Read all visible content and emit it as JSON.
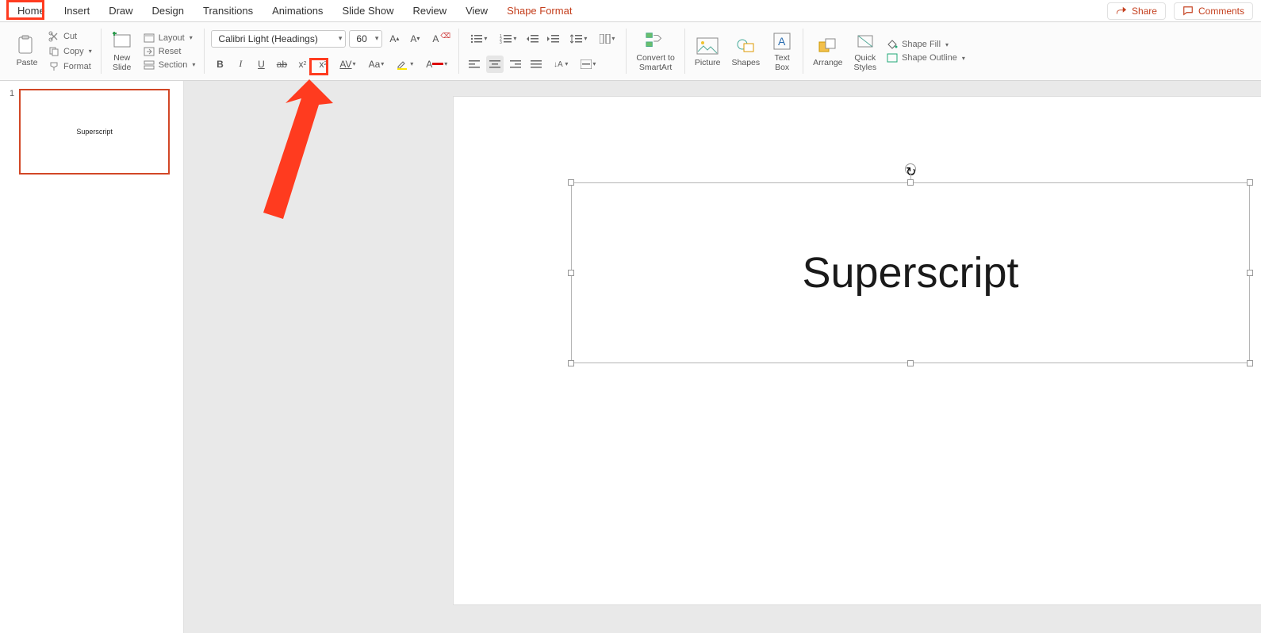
{
  "tabs": {
    "home": "Home",
    "insert": "Insert",
    "draw": "Draw",
    "design": "Design",
    "transitions": "Transitions",
    "animations": "Animations",
    "slideshow": "Slide Show",
    "review": "Review",
    "view": "View",
    "shape_format": "Shape Format"
  },
  "topright": {
    "share": "Share",
    "comments": "Comments"
  },
  "clipboard": {
    "paste": "Paste",
    "cut": "Cut",
    "copy": "Copy",
    "format": "Format"
  },
  "slides": {
    "new_slide": "New\nSlide",
    "layout": "Layout",
    "reset": "Reset",
    "section": "Section"
  },
  "font": {
    "name": "Calibri Light (Headings)",
    "size": "60"
  },
  "para": {},
  "insertgrp": {
    "convert": "Convert to\nSmartArt",
    "picture": "Picture",
    "shapes": "Shapes",
    "textbox": "Text\nBox",
    "arrange": "Arrange",
    "quickstyles": "Quick\nStyles",
    "shapefill": "Shape Fill",
    "shapeoutline": "Shape Outline"
  },
  "thumb": {
    "num": "1",
    "text": "Superscript"
  },
  "slide": {
    "title": "Superscript"
  }
}
